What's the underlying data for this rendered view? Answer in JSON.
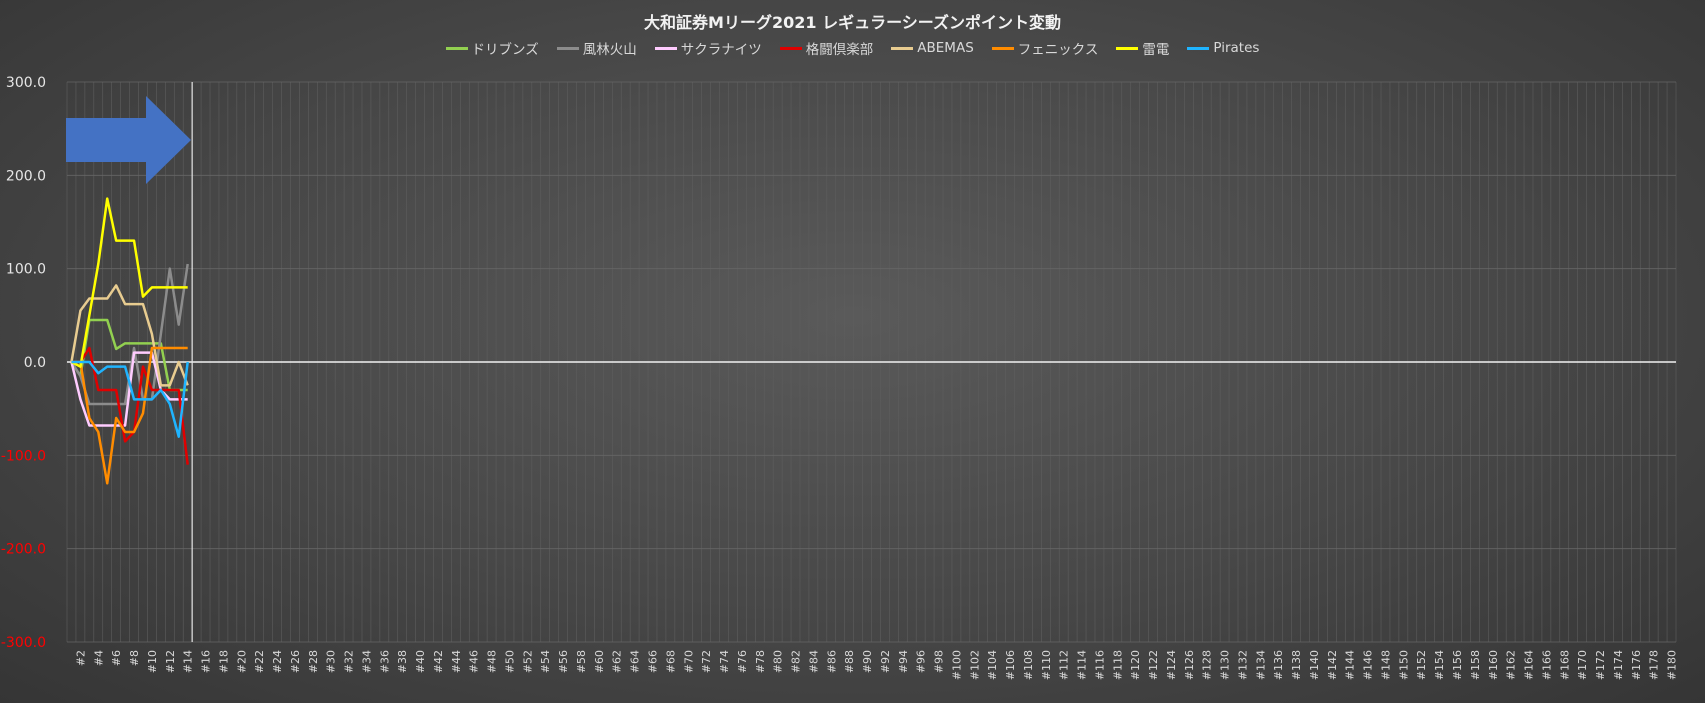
{
  "chart_data": {
    "type": "line",
    "title": "大和証券Mリーグ2021 レギュラーシーズンポイント変動",
    "ylim": [
      -300,
      300
    ],
    "yticks": [
      "300.0",
      "200.0",
      "100.0",
      "0.0",
      "-100.0",
      "-200.0",
      "-300.0"
    ],
    "negative_tick_color": "#ff0000",
    "x_count": 180,
    "x_tick_step": 2,
    "x_tick_prefix": "#",
    "grid": true,
    "legend_position": "top",
    "current_game_marker": 14,
    "series": [
      {
        "name": "ドリブンズ",
        "color": "#92d050",
        "values": [
          0,
          -15,
          45,
          45,
          45,
          14,
          20,
          20,
          20,
          20,
          20,
          -30,
          -30,
          -30
        ]
      },
      {
        "name": "風林火山",
        "color": "#8c8c8c",
        "values": [
          0,
          -15,
          -45,
          -45,
          -45,
          -45,
          -45,
          15,
          -40,
          -40,
          30,
          100,
          40,
          105
        ]
      },
      {
        "name": "サクラナイツ",
        "color": "#ffccff",
        "values": [
          0,
          -40,
          -68,
          -68,
          -68,
          -68,
          -68,
          10,
          10,
          10,
          -30,
          -40,
          -40,
          -40
        ]
      },
      {
        "name": "格闘倶楽部",
        "color": "#e00000",
        "values": [
          0,
          0,
          15,
          -30,
          -30,
          -30,
          -85,
          -75,
          -5,
          -30,
          -30,
          -30,
          -30,
          -110
        ]
      },
      {
        "name": "ABEMAS",
        "color": "#e8cc90",
        "values": [
          0,
          55,
          68,
          68,
          68,
          82,
          62,
          62,
          62,
          30,
          -25,
          -25,
          0,
          -25
        ]
      },
      {
        "name": "フェニックス",
        "color": "#ff8c00",
        "values": [
          0,
          0,
          -60,
          -75,
          -130,
          -60,
          -75,
          -75,
          -55,
          15,
          15,
          15,
          15,
          15
        ]
      },
      {
        "name": "雷電",
        "color": "#ffff00",
        "values": [
          0,
          -5,
          50,
          105,
          175,
          130,
          130,
          130,
          70,
          80,
          80,
          80,
          80,
          80
        ]
      },
      {
        "name": "Pirates",
        "color": "#1fb4ff",
        "values": [
          0,
          0,
          0,
          -12,
          -5,
          -5,
          -5,
          -40,
          -40,
          -40,
          -30,
          -45,
          -80,
          0
        ]
      }
    ]
  }
}
